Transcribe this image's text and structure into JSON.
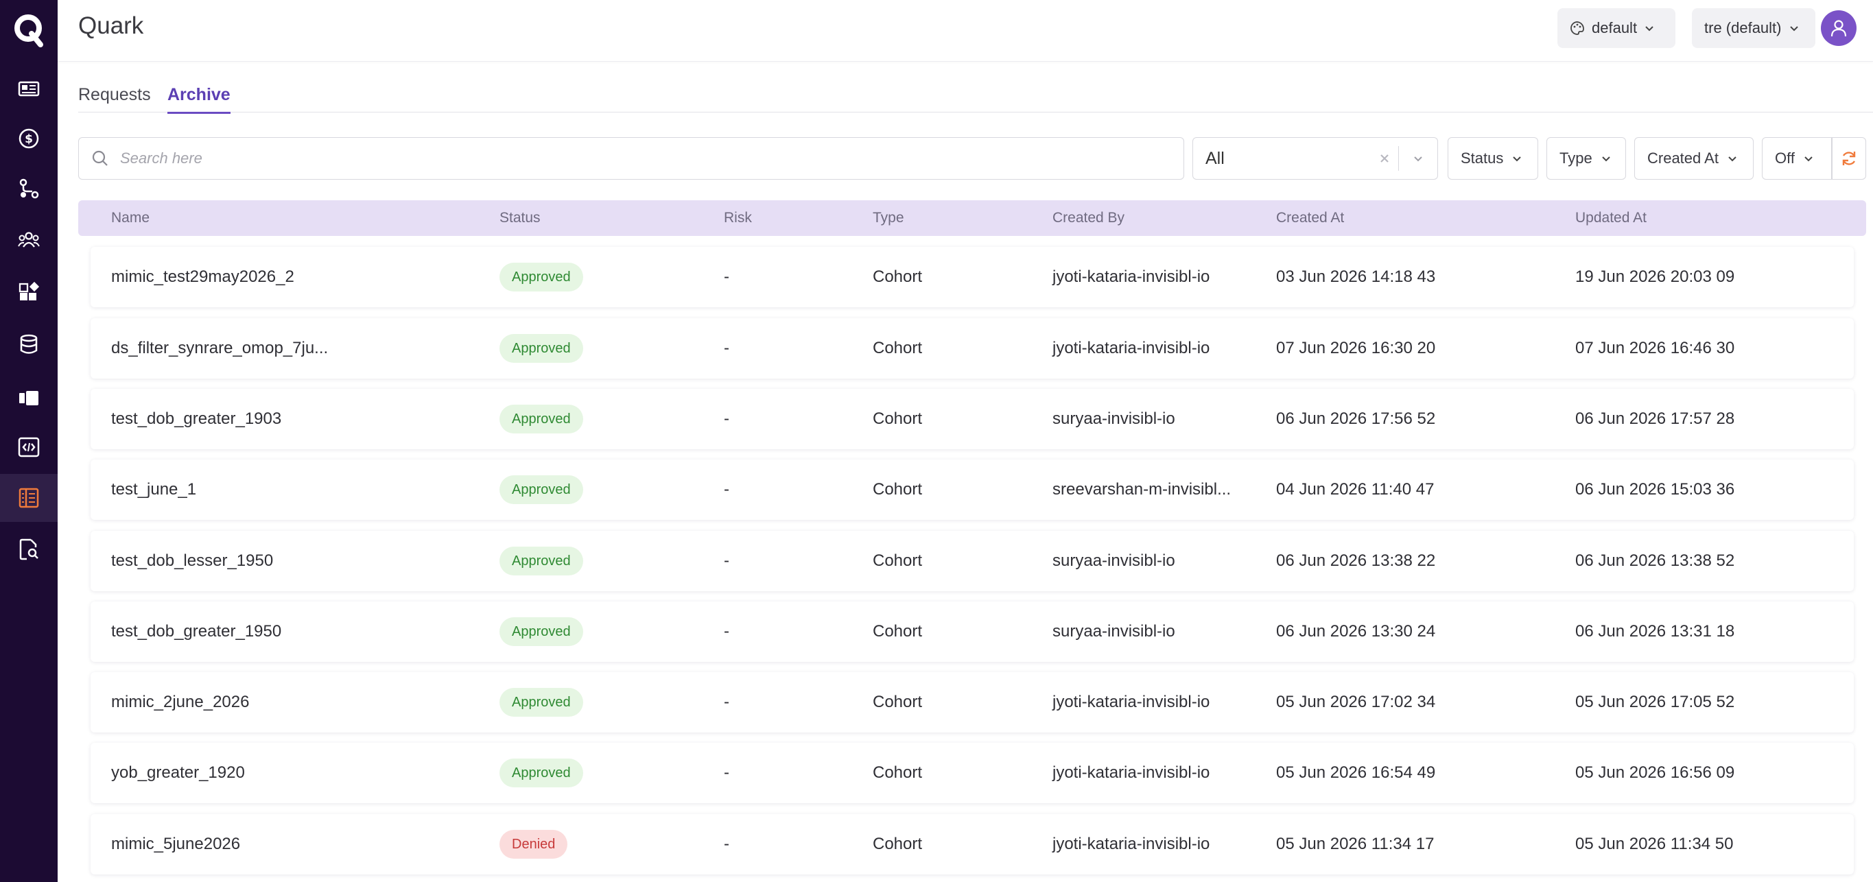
{
  "app": {
    "title": "Quark"
  },
  "header": {
    "theme_label": "default",
    "workspace_label": "tre (default)"
  },
  "tabs": [
    {
      "label": "Requests",
      "active": false
    },
    {
      "label": "Archive",
      "active": true
    }
  ],
  "filters": {
    "search_placeholder": "Search here",
    "scope_value": "All",
    "status_label": "Status",
    "type_label": "Type",
    "created_at_label": "Created At",
    "auto_refresh_label": "Off"
  },
  "table": {
    "columns": [
      "Name",
      "Status",
      "Risk",
      "Type",
      "Created By",
      "Created At",
      "Updated At"
    ],
    "rows": [
      {
        "name": "mimic_test29may2026_2",
        "status": "Approved",
        "risk": "-",
        "type": "Cohort",
        "created_by": "jyoti-kataria-invisibl-io",
        "created_at": "03 Jun 2026 14:18 43",
        "updated_at": "19 Jun 2026 20:03 09"
      },
      {
        "name": "ds_filter_synrare_omop_7ju...",
        "status": "Approved",
        "risk": "-",
        "type": "Cohort",
        "created_by": "jyoti-kataria-invisibl-io",
        "created_at": "07 Jun 2026 16:30 20",
        "updated_at": "07 Jun 2026 16:46 30"
      },
      {
        "name": "test_dob_greater_1903",
        "status": "Approved",
        "risk": "-",
        "type": "Cohort",
        "created_by": "suryaa-invisibl-io",
        "created_at": "06 Jun 2026 17:56 52",
        "updated_at": "06 Jun 2026 17:57 28"
      },
      {
        "name": "test_june_1",
        "status": "Approved",
        "risk": "-",
        "type": "Cohort",
        "created_by": "sreevarshan-m-invisibl...",
        "created_at": "04 Jun 2026 11:40 47",
        "updated_at": "06 Jun 2026 15:03 36"
      },
      {
        "name": "test_dob_lesser_1950",
        "status": "Approved",
        "risk": "-",
        "type": "Cohort",
        "created_by": "suryaa-invisibl-io",
        "created_at": "06 Jun 2026 13:38 22",
        "updated_at": "06 Jun 2026 13:38 52"
      },
      {
        "name": "test_dob_greater_1950",
        "status": "Approved",
        "risk": "-",
        "type": "Cohort",
        "created_by": "suryaa-invisibl-io",
        "created_at": "06 Jun 2026 13:30 24",
        "updated_at": "06 Jun 2026 13:31 18"
      },
      {
        "name": "mimic_2june_2026",
        "status": "Approved",
        "risk": "-",
        "type": "Cohort",
        "created_by": "jyoti-kataria-invisibl-io",
        "created_at": "05 Jun 2026 17:02 34",
        "updated_at": "05 Jun 2026 17:05 52"
      },
      {
        "name": "yob_greater_1920",
        "status": "Approved",
        "risk": "-",
        "type": "Cohort",
        "created_by": "jyoti-kataria-invisibl-io",
        "created_at": "05 Jun 2026 16:54 49",
        "updated_at": "05 Jun 2026 16:56 09"
      },
      {
        "name": "mimic_5june2026",
        "status": "Denied",
        "risk": "-",
        "type": "Cohort",
        "created_by": "jyoti-kataria-invisibl-io",
        "created_at": "05 Jun 2026 11:34 17",
        "updated_at": "05 Jun 2026 11:34 50"
      }
    ]
  },
  "sidebar": {
    "items": [
      {
        "icon": "news-icon",
        "active": false
      },
      {
        "icon": "dollar-icon",
        "active": false
      },
      {
        "icon": "workflow-icon",
        "active": false
      },
      {
        "icon": "users-icon",
        "active": false
      },
      {
        "icon": "widgets-icon",
        "active": false
      },
      {
        "icon": "database-icon",
        "active": false
      },
      {
        "icon": "cards-icon",
        "active": false
      },
      {
        "icon": "code-icon",
        "active": false
      },
      {
        "icon": "table-icon",
        "active": true
      },
      {
        "icon": "document-search-icon",
        "active": false
      }
    ]
  },
  "colors": {
    "sidebar_bg": "#1c0b33",
    "accent": "#6a4bc2",
    "active_icon": "#f07b3c",
    "approved": "#2f8a33",
    "denied": "#c73a3a"
  }
}
